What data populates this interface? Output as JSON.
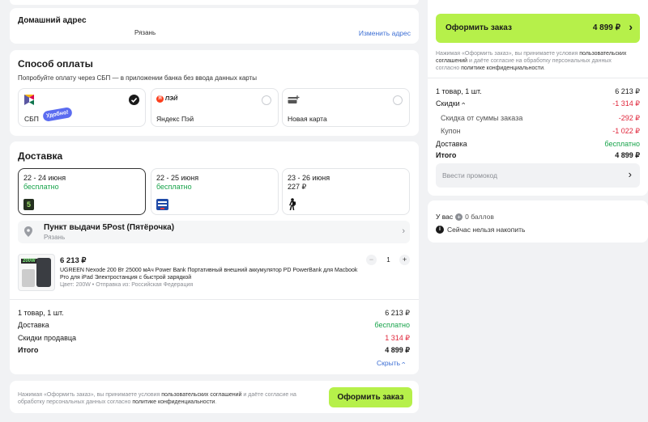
{
  "address": {
    "title": "Домашний адрес",
    "city": "Рязань",
    "change_link": "Изменить адрес"
  },
  "payment": {
    "title": "Способ оплаты",
    "hint": "Попробуйте оплату через СБП — в приложении банка без ввода данных карты",
    "options": [
      {
        "label": "СБП",
        "badge": "Удобно!",
        "selected": true
      },
      {
        "label": "Яндекс Пэй",
        "logo_text": "ПЭЙ",
        "selected": false
      },
      {
        "label": "Новая карта",
        "selected": false
      }
    ]
  },
  "delivery": {
    "title": "Доставка",
    "options": [
      {
        "dates": "22 - 24 июня",
        "price": "бесплатно",
        "carrier_icon": "5post-logo",
        "selected": true
      },
      {
        "dates": "22 - 25 июня",
        "price": "бесплатно",
        "carrier_icon": "pochta-rossii-logo",
        "selected": false
      },
      {
        "dates": "23 - 26 июня",
        "price": "227 ₽",
        "carrier_icon": "courier-walking-icon",
        "selected": false
      }
    ],
    "pickup": {
      "title": "Пункт выдачи 5Post (Пятёрочка)",
      "city": "Рязань"
    }
  },
  "product": {
    "price": "6 213 ₽",
    "name": "UGREEN Nexode 200 Вт 25000 мАч Power Bank Портативный внешний аккумулятор PD PowerBank для Macbook Pro для iPad Электростанция с быстрой зарядкой",
    "meta": "Цвет: 200W • Отправка из: Российская Федерация",
    "image_label": "200W",
    "quantity": "1",
    "minus": "−",
    "plus": "+"
  },
  "order_totals": {
    "items_label": "1 товар, 1 шт.",
    "items_value": "6 213 ₽",
    "delivery_label": "Доставка",
    "delivery_value": "бесплатно",
    "discount_label": "Скидки продавца",
    "discount_value": "1 314 ₽",
    "total_label": "Итого",
    "total_value": "4 899 ₽",
    "collapse_link": "Скрыть"
  },
  "footer": {
    "consent_prefix": "Нажимая «Оформить заказ», вы принимаете условия",
    "consent_link1": "пользовательских соглашений",
    "consent_middle": "и даёте согласие на обработку персональных данных согласно",
    "consent_link2": "политике конфиденциальности",
    "button": "Оформить заказ"
  },
  "sidebar": {
    "button_label": "Оформить заказ",
    "button_price": "4 899 ₽",
    "consent_prefix": "Нажимая «Оформить заказ», вы принимаете условия",
    "consent_link1": "пользовательских соглашений",
    "consent_middle": "и даёте согласие на обработку персональных данных согласно",
    "consent_link2": "политике конфиденциальности",
    "items_label": "1 товар, 1 шт.",
    "items_value": "6 213 ₽",
    "discounts_label": "Скидки",
    "discounts_value": "-1 314 ₽",
    "sum_discount_label": "Скидка от суммы заказа",
    "sum_discount_value": "-292 ₽",
    "coupon_label": "Купон",
    "coupon_value": "-1 022 ₽",
    "delivery_label": "Доставка",
    "delivery_value": "бесплатно",
    "total_label": "Итого",
    "total_value": "4 899 ₽",
    "promo_placeholder": "Ввести промокод",
    "points_prefix": "У вас",
    "points_value": "0 баллов",
    "points_note": "Сейчас нельзя накопить"
  },
  "colors": {
    "accent_green": "#b6f04a",
    "success_green": "#17a34a",
    "discount_red": "#e0253a",
    "link_blue": "#3d6fd4"
  }
}
